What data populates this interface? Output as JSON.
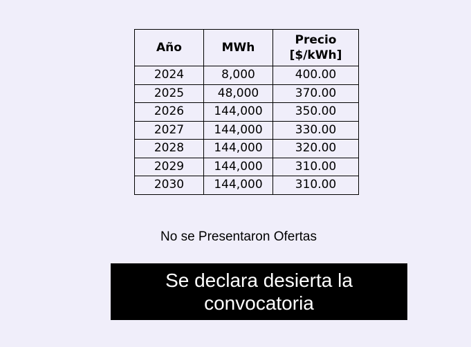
{
  "table": {
    "headers": {
      "anio": "Año",
      "mwh": "MWh",
      "precio_line1": "Precio",
      "precio_line2": "[$/kWh]"
    },
    "rows": [
      {
        "anio": "2024",
        "mwh": "8,000",
        "precio": "400.00"
      },
      {
        "anio": "2025",
        "mwh": "48,000",
        "precio": "370.00"
      },
      {
        "anio": "2026",
        "mwh": "144,000",
        "precio": "350.00"
      },
      {
        "anio": "2027",
        "mwh": "144,000",
        "precio": "330.00"
      },
      {
        "anio": "2028",
        "mwh": "144,000",
        "precio": "320.00"
      },
      {
        "anio": "2029",
        "mwh": "144,000",
        "precio": "310.00"
      },
      {
        "anio": "2030",
        "mwh": "144,000",
        "precio": "310.00"
      }
    ]
  },
  "notice": {
    "no_offers": "No se Presentaron Ofertas",
    "banner_line1": "Se declara desierta la",
    "banner_line2": "convocatoria"
  },
  "colors": {
    "background": "#f0eefa",
    "banner_background": "#000000",
    "banner_text": "#ffffff"
  }
}
